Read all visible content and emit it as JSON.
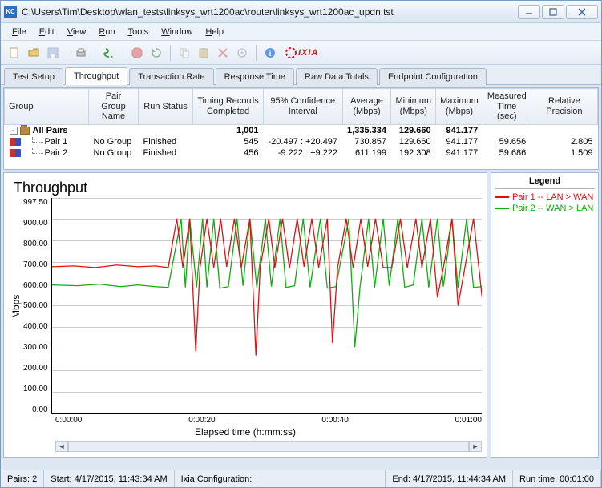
{
  "window": {
    "title": "C:\\Users\\Tim\\Desktop\\wlan_tests\\linksys_wrt1200ac\\router\\linksys_wrt1200ac_updn.tst",
    "app_badge": "KC"
  },
  "menu": [
    "File",
    "Edit",
    "View",
    "Run",
    "Tools",
    "Window",
    "Help"
  ],
  "brand": "IXIA",
  "tabs": [
    "Test Setup",
    "Throughput",
    "Transaction Rate",
    "Response Time",
    "Raw Data Totals",
    "Endpoint Configuration"
  ],
  "active_tab": 1,
  "columns": [
    "Group",
    "Pair Group Name",
    "Run Status",
    "Timing Records Completed",
    "95% Confidence Interval",
    "Average (Mbps)",
    "Minimum (Mbps)",
    "Maximum (Mbps)",
    "Measured Time (sec)",
    "Relative Precision"
  ],
  "rows": {
    "summary": {
      "group": "All Pairs",
      "records": "1,001",
      "avg": "1,335.334",
      "min": "129.660",
      "max": "941.177"
    },
    "pairs": [
      {
        "group": "Pair 1",
        "pgname": "No Group",
        "status": "Finished",
        "records": "545",
        "ci": "-20.497 : +20.497",
        "avg": "730.857",
        "min": "129.660",
        "max": "941.177",
        "time": "59.656",
        "prec": "2.805"
      },
      {
        "group": "Pair 2",
        "pgname": "No Group",
        "status": "Finished",
        "records": "456",
        "ci": "-9.222 : +9.222",
        "avg": "611.199",
        "min": "192.308",
        "max": "941.177",
        "time": "59.686",
        "prec": "1.509"
      }
    ]
  },
  "chart": {
    "title": "Throughput",
    "ylabel": "Mbps",
    "xlabel": "Elapsed time (h:mm:ss)",
    "yticks": [
      "997.50",
      "900.00",
      "800.00",
      "700.00",
      "600.00",
      "500.00",
      "400.00",
      "300.00",
      "200.00",
      "100.00",
      "0.00"
    ],
    "xticks": [
      "0:00:00",
      "0:00:20",
      "0:00:40",
      "0:01:00"
    ]
  },
  "chart_data": {
    "type": "line",
    "xlabel": "Elapsed time (h:mm:ss)",
    "ylabel": "Mbps",
    "title": "Throughput",
    "ylim": [
      0,
      997.5
    ],
    "xlim_seconds": [
      0,
      60
    ],
    "series": [
      {
        "name": "Pair 1 -- LAN > WAN",
        "color": "#d11",
        "values_note": "fluctuates around ~680 Mbps with frequent spikes up to ~940 and dips to ~280; min 129.66, max 941.18, avg 730.86"
      },
      {
        "name": "Pair 2 -- WAN > LAN",
        "color": "#1a1",
        "values_note": "fluctuates around ~595 Mbps with spikes to ~940 and dips to ~300; min 192.31, max 941.18, avg 611.20"
      }
    ]
  },
  "legend": {
    "title": "Legend",
    "items": [
      {
        "color": "#d11",
        "label": "Pair 1 -- LAN > WAN"
      },
      {
        "color": "#1a1",
        "label": "Pair 2 -- WAN > LAN"
      }
    ]
  },
  "status": {
    "pairs": "Pairs: 2",
    "start": "Start: 4/17/2015, 11:43:34 AM",
    "config": "Ixia Configuration:",
    "end": "End: 4/17/2015, 11:44:34 AM",
    "runtime": "Run time: 00:01:00"
  }
}
